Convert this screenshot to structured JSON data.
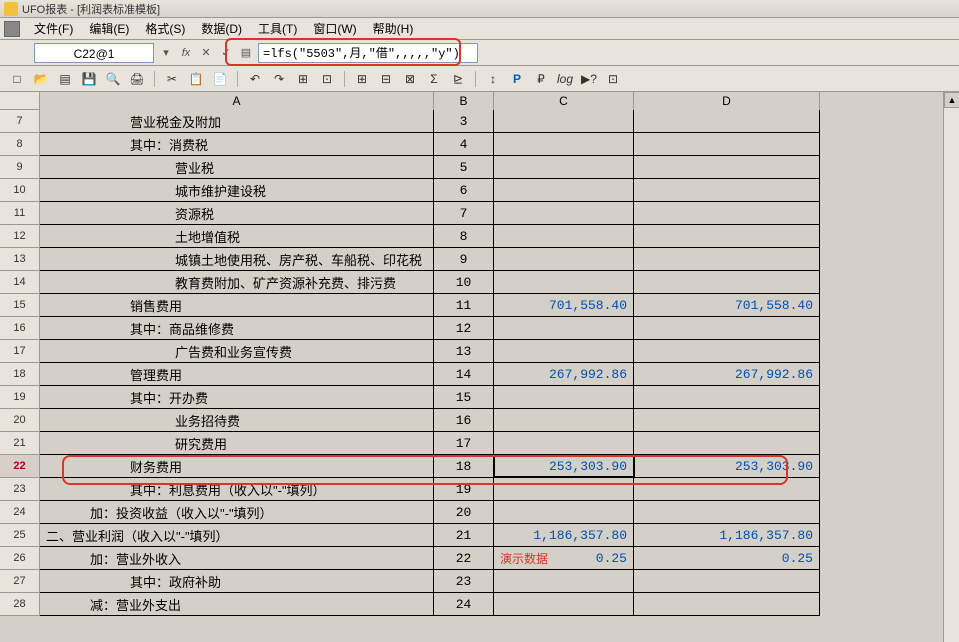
{
  "title": "UFO报表 - [利润表标准模板]",
  "menu": {
    "items": [
      "文件(F)",
      "编辑(E)",
      "格式(S)",
      "数据(D)",
      "工具(T)",
      "窗口(W)",
      "帮助(H)"
    ]
  },
  "formula_bar": {
    "cell_ref": "C22@1",
    "formula": "=lfs(\"5503\",月,\"借\",,,,,\"y\")"
  },
  "columns": [
    "A",
    "B",
    "C",
    "D"
  ],
  "rows": [
    {
      "n": 7,
      "a": "营业税金及附加",
      "indent": 2,
      "b": "3",
      "c": "",
      "d": ""
    },
    {
      "n": 8,
      "a": "其中：消费税",
      "indent": 2,
      "b": "4",
      "c": "",
      "d": ""
    },
    {
      "n": 9,
      "a": "营业税",
      "indent": 3,
      "b": "5",
      "c": "",
      "d": ""
    },
    {
      "n": 10,
      "a": "城市维护建设税",
      "indent": 3,
      "b": "6",
      "c": "",
      "d": ""
    },
    {
      "n": 11,
      "a": "资源税",
      "indent": 3,
      "b": "7",
      "c": "",
      "d": ""
    },
    {
      "n": 12,
      "a": "土地增值税",
      "indent": 3,
      "b": "8",
      "c": "",
      "d": ""
    },
    {
      "n": 13,
      "a": "城镇土地使用税、房产税、车船税、印花税",
      "indent": 3,
      "b": "9",
      "c": "",
      "d": ""
    },
    {
      "n": 14,
      "a": "教育费附加、矿产资源补充费、排污费",
      "indent": 3,
      "b": "10",
      "c": "",
      "d": ""
    },
    {
      "n": 15,
      "a": "销售费用",
      "indent": 2,
      "b": "11",
      "c": "701,558.40",
      "d": "701,558.40"
    },
    {
      "n": 16,
      "a": "其中：商品维修费",
      "indent": 2,
      "b": "12",
      "c": "",
      "d": ""
    },
    {
      "n": 17,
      "a": "广告费和业务宣传费",
      "indent": 3,
      "b": "13",
      "c": "",
      "d": ""
    },
    {
      "n": 18,
      "a": "管理费用",
      "indent": 2,
      "b": "14",
      "c": "267,992.86",
      "d": "267,992.86"
    },
    {
      "n": 19,
      "a": "其中：开办费",
      "indent": 2,
      "b": "15",
      "c": "",
      "d": ""
    },
    {
      "n": 20,
      "a": "业务招待费",
      "indent": 3,
      "b": "16",
      "c": "",
      "d": ""
    },
    {
      "n": 21,
      "a": "研究费用",
      "indent": 3,
      "b": "17",
      "c": "",
      "d": ""
    },
    {
      "n": 22,
      "a": "财务费用",
      "indent": 2,
      "b": "18",
      "c": "253,303.90",
      "d": "253,303.90",
      "selected": true
    },
    {
      "n": 23,
      "a": "其中：利息费用（收入以\"-\"填列）",
      "indent": 2,
      "b": "19",
      "c": "",
      "d": ""
    },
    {
      "n": 24,
      "a": "加：投资收益（收入以\"-\"填列）",
      "indent": 1,
      "b": "20",
      "c": "",
      "d": ""
    },
    {
      "n": 25,
      "a": "二、营业利润（收入以\"-\"填列）",
      "indent": 0,
      "b": "21",
      "c": "1,186,357.80",
      "d": "1,186,357.80"
    },
    {
      "n": 26,
      "a": "加：营业外收入",
      "indent": 1,
      "b": "22",
      "c": "0.25",
      "d": "0.25",
      "demo": "演示数据"
    },
    {
      "n": 27,
      "a": "其中：政府补助",
      "indent": 2,
      "b": "23",
      "c": "",
      "d": ""
    },
    {
      "n": 28,
      "a": "减：营业外支出",
      "indent": 1,
      "b": "24",
      "c": "",
      "d": ""
    }
  ],
  "toolbar_icons": [
    "□",
    "📂",
    "▤",
    "💾",
    "🖶",
    "🖨",
    "|",
    "✂",
    "📋",
    "📄",
    "|",
    "↶",
    "↷",
    "⊞",
    "⊡",
    "|",
    "⊞",
    "⊟",
    "⊠",
    "Σ",
    "⊵",
    "|",
    "↕",
    "P",
    "₽",
    "log",
    "▶?",
    "⊡"
  ]
}
